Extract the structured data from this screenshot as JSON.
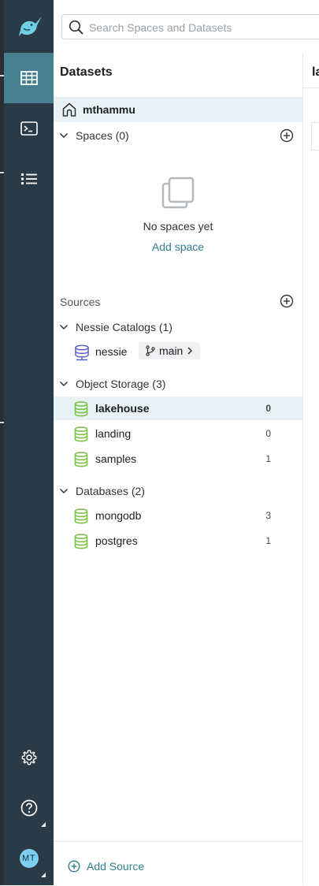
{
  "search": {
    "placeholder": "Search Spaces and Datasets"
  },
  "rail": {
    "items": [
      {
        "icon": "datasets-grid-icon",
        "active": true
      },
      {
        "icon": "sql-terminal-icon",
        "active": false
      },
      {
        "icon": "jobs-list-icon",
        "active": false
      }
    ],
    "settings_icon": "gear-icon",
    "help_icon": "help-icon",
    "avatar_initials": "MT"
  },
  "panel": {
    "title": "Datasets",
    "home": {
      "label": "mthammu"
    },
    "spaces": {
      "label": "Spaces (0)",
      "empty_text": "No spaces yet",
      "add_label": "Add space"
    },
    "sources_label": "Sources",
    "groups": [
      {
        "label": "Nessie Catalogs (1)",
        "items": [
          {
            "name": "nessie",
            "branch": "main"
          }
        ]
      },
      {
        "label": "Object Storage (3)",
        "items": [
          {
            "name": "lakehouse",
            "count": "0",
            "selected": true
          },
          {
            "name": "landing",
            "count": "0"
          },
          {
            "name": "samples",
            "count": "1"
          }
        ]
      },
      {
        "label": "Databases (2)",
        "items": [
          {
            "name": "mongodb",
            "count": "3"
          },
          {
            "name": "postgres",
            "count": "1"
          }
        ]
      }
    ],
    "footer": {
      "add_source_label": "Add Source"
    }
  },
  "right_panel": {
    "title_fragment": "la"
  },
  "colors": {
    "rail": "#2a3a46",
    "rail_active": "#47818f",
    "accent": "#2f7f8e",
    "source_icon": "#7cc243",
    "nessie_icon": "#5d5fc7",
    "selected_row": "#e8f2f5"
  }
}
